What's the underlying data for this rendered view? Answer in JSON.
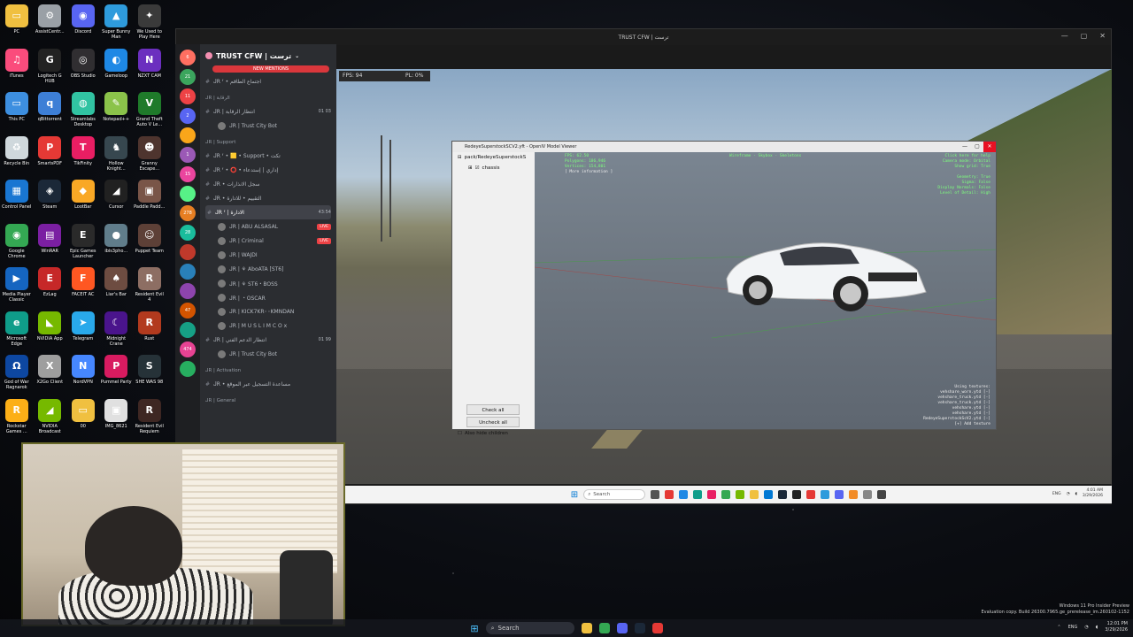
{
  "desktop": {
    "icons": [
      {
        "label": "PC",
        "color": "#f0c040",
        "glyph": "▭"
      },
      {
        "label": "AssistCentr...",
        "color": "#9aa0a6",
        "glyph": "⚙"
      },
      {
        "label": "Discord",
        "color": "#5865f2",
        "glyph": "◉"
      },
      {
        "label": "Super Bunny Man",
        "color": "#2e9bdc",
        "glyph": "▲"
      },
      {
        "label": "We Used to Play Here",
        "color": "#3a3a3a",
        "glyph": "✦"
      },
      {
        "label": "iTunes",
        "color": "#fa4c7c",
        "glyph": "♫"
      },
      {
        "label": "Logitech G HUB",
        "color": "#222",
        "glyph": "G"
      },
      {
        "label": "OBS Studio",
        "color": "#302e31",
        "glyph": "◎"
      },
      {
        "label": "Gameloop",
        "color": "#1e88e5",
        "glyph": "◐"
      },
      {
        "label": "NZXT CAM",
        "color": "#6b2fbf",
        "glyph": "N"
      },
      {
        "label": "This PC",
        "color": "#3d8fe0",
        "glyph": "▭"
      },
      {
        "label": "qBittorrent",
        "color": "#3d7fd6",
        "glyph": "q"
      },
      {
        "label": "Streamlabs Desktop",
        "color": "#31c3a2",
        "glyph": "◍"
      },
      {
        "label": "Notepad++",
        "color": "#8bc34a",
        "glyph": "✎"
      },
      {
        "label": "Grand Theft Auto V Le...",
        "color": "#1f7a2a",
        "glyph": "V"
      },
      {
        "label": "Recycle Bin",
        "color": "#cfd8dc",
        "glyph": "♻"
      },
      {
        "label": "SmartsPDF",
        "color": "#e53935",
        "glyph": "P"
      },
      {
        "label": "TikFinity",
        "color": "#e91e63",
        "glyph": "T"
      },
      {
        "label": "Hollow Knight...",
        "color": "#37474f",
        "glyph": "♞"
      },
      {
        "label": "Granny Escape...",
        "color": "#4e342e",
        "glyph": "☻"
      },
      {
        "label": "Control Panel",
        "color": "#1976d2",
        "glyph": "▦"
      },
      {
        "label": "Steam",
        "color": "#1b2838",
        "glyph": "◈"
      },
      {
        "label": "LootBar",
        "color": "#f9a825",
        "glyph": "◆"
      },
      {
        "label": "Cursor",
        "color": "#212121",
        "glyph": "◢"
      },
      {
        "label": "Paddle Padd...",
        "color": "#795548",
        "glyph": "▣"
      },
      {
        "label": "Google Chrome",
        "color": "#34a853",
        "glyph": "◉"
      },
      {
        "label": "WinRAR",
        "color": "#7b1fa2",
        "glyph": "▤"
      },
      {
        "label": "Epic Games Launcher",
        "color": "#2a2a2a",
        "glyph": "E"
      },
      {
        "label": "ibis3pho...",
        "color": "#607d8b",
        "glyph": "●"
      },
      {
        "label": "Puppet Team",
        "color": "#5d4037",
        "glyph": "☺"
      },
      {
        "label": "Media Player Classic",
        "color": "#1565c0",
        "glyph": "▶"
      },
      {
        "label": "EzLag",
        "color": "#c62828",
        "glyph": "E"
      },
      {
        "label": "FACEIT AC",
        "color": "#ff5722",
        "glyph": "F"
      },
      {
        "label": "Liar's Bar",
        "color": "#6d4c41",
        "glyph": "♠"
      },
      {
        "label": "Resident Evil 4",
        "color": "#8d6e63",
        "glyph": "R"
      },
      {
        "label": "Microsoft Edge",
        "color": "#0f9d8a",
        "glyph": "e"
      },
      {
        "label": "NVIDIA App",
        "color": "#76b900",
        "glyph": "◣"
      },
      {
        "label": "Telegram",
        "color": "#29a9eb",
        "glyph": "➤"
      },
      {
        "label": "Midnight Crane",
        "color": "#4a148c",
        "glyph": "☾"
      },
      {
        "label": "Rust",
        "color": "#b23a1e",
        "glyph": "R"
      },
      {
        "label": "God of War Ragnarok",
        "color": "#0d47a1",
        "glyph": "Ω"
      },
      {
        "label": "X2Go Client",
        "color": "#9e9e9e",
        "glyph": "X"
      },
      {
        "label": "NordVPN",
        "color": "#4687ff",
        "glyph": "N"
      },
      {
        "label": "Pummel Party",
        "color": "#d81b60",
        "glyph": "P"
      },
      {
        "label": "SHE WAS 98",
        "color": "#263238",
        "glyph": "S"
      },
      {
        "label": "Rockstar Games ...",
        "color": "#fcaf17",
        "glyph": "R"
      },
      {
        "label": "NVIDIA Broadcast",
        "color": "#76b900",
        "glyph": "◢"
      },
      {
        "label": "00",
        "color": "#f0c040",
        "glyph": "▭"
      },
      {
        "label": "IMG_8621",
        "color": "#e0e0e0",
        "glyph": "▣"
      },
      {
        "label": "Resident Evil Requiem",
        "color": "#3e2723",
        "glyph": "R"
      }
    ]
  },
  "stream_window": {
    "title": "TRUST CFW | ترست"
  },
  "discord": {
    "server_name": "TRUST CFW | ترست",
    "new_mentions": "NEW MENTIONS",
    "channels": [
      {
        "type": "chan",
        "text": "ᒍR ᶠ • اجتماع الطاقم"
      },
      {
        "type": "cat",
        "text": "ᒍR | الرقابة"
      },
      {
        "type": "chan",
        "text": "ᒍR | انتظار الرقابة",
        "right": "01 03"
      },
      {
        "type": "voice",
        "text": "ᒍR | Trust City Bot"
      },
      {
        "type": "cat",
        "text": "ᒍR | Support"
      },
      {
        "type": "chan",
        "text": "ᒍR ᶠ • 🟨 • Support • تكت"
      },
      {
        "type": "chan",
        "text": "ᒍR ᶠ • ⭕ • إداري | إستدعاء"
      },
      {
        "type": "chan",
        "text": "ᒍR • سجل الانذارات"
      },
      {
        "type": "chan",
        "text": "ᒍR • التقييم • للادارة"
      },
      {
        "type": "active",
        "text": "ᒍR ᶠ | الادارة",
        "right": "43:54"
      },
      {
        "type": "live",
        "text": "ᒍR | ABU ALSASAL"
      },
      {
        "type": "live",
        "text": "ᒍR | Criminal"
      },
      {
        "type": "voice",
        "text": "ᒍR | WAJDI"
      },
      {
        "type": "voice",
        "text": "ᒍR | ⚘ AboATA [ST6]"
      },
      {
        "type": "voice",
        "text": "ᒍR | ⚘ ST6・BOSS"
      },
      {
        "type": "voice",
        "text": "ᒍR | ・OSCAR"
      },
      {
        "type": "voice",
        "text": "ᒍR | KICK7KR◦◦KMNDAN"
      },
      {
        "type": "voice",
        "text": "ᒍR | M U S L I M C O x"
      },
      {
        "type": "chan",
        "text": "ᒍR | انتظار الدعم الفني",
        "right": "01 99"
      },
      {
        "type": "voice",
        "text": "ᒍR | Trust City Bot"
      },
      {
        "type": "cat",
        "text": "ᒍR | Activation"
      },
      {
        "type": "chan",
        "text": "ᒍR • مساعدة التسجيل عبر الموقع"
      },
      {
        "type": "cat",
        "text": "ᒍR | General"
      }
    ],
    "guild_badges": [
      "6",
      "21",
      "11",
      "2",
      "",
      "1",
      "15",
      "",
      "278",
      "28",
      "",
      "",
      "",
      "47",
      "",
      "474",
      ""
    ]
  },
  "game": {
    "fps": "FPS: 94",
    "pl": "PL: 0%"
  },
  "viewer": {
    "title": "RedeyeSuperstockSCV2.yft - OpenIV Model Viewer",
    "tree_root": "pack/RedeyeSuperstockS",
    "tree_child": "chassis",
    "check_all": "Check all",
    "uncheck_all": "Uncheck all",
    "also_hide": "Also hide children",
    "hud_left_1": "FPS: 62.50",
    "hud_left_2": "Polygons: 186,946",
    "hud_left_3": "Vertices: 154,801",
    "hud_left_4": "[ More information ]",
    "hud_top": "Wireframe · Skybox · Skeletons",
    "hud_right": [
      "Click here for help",
      "Camera mode: Orbital",
      "Show grid: True",
      "",
      "Geometry: True",
      "Sigma: False",
      "Display Normals: False",
      "Level of Detail: High"
    ],
    "hud_bottom": [
      "Using textures:",
      "vehshare_worn.ytd [-]",
      "vehshare_truck.ytd [-]",
      "vehshare_truck.ytd [-]",
      "vehshare.ytd [-]",
      "vehshare.ytd [-]",
      "RedeyeSuperstockScV2.ytd [-]",
      "[+] Add texture"
    ]
  },
  "inner_taskbar": {
    "search": "Search",
    "time": "4:01 AM",
    "date": "3/29/2026",
    "lang": "ENG"
  },
  "taskbar": {
    "search": "Search",
    "time": "12:01 PM",
    "date": "3/29/2026",
    "lang": "ENG"
  },
  "watermark": {
    "line1": "Windows 11 Pro Insider Preview",
    "line2": "Evaluation copy. Build 26300.7965.ge_prerelease_im.260102-1152"
  },
  "colors": {
    "discord_bg": "#2b2d31",
    "mention_red": "#da373c",
    "hud_green": "#7dff7d"
  }
}
